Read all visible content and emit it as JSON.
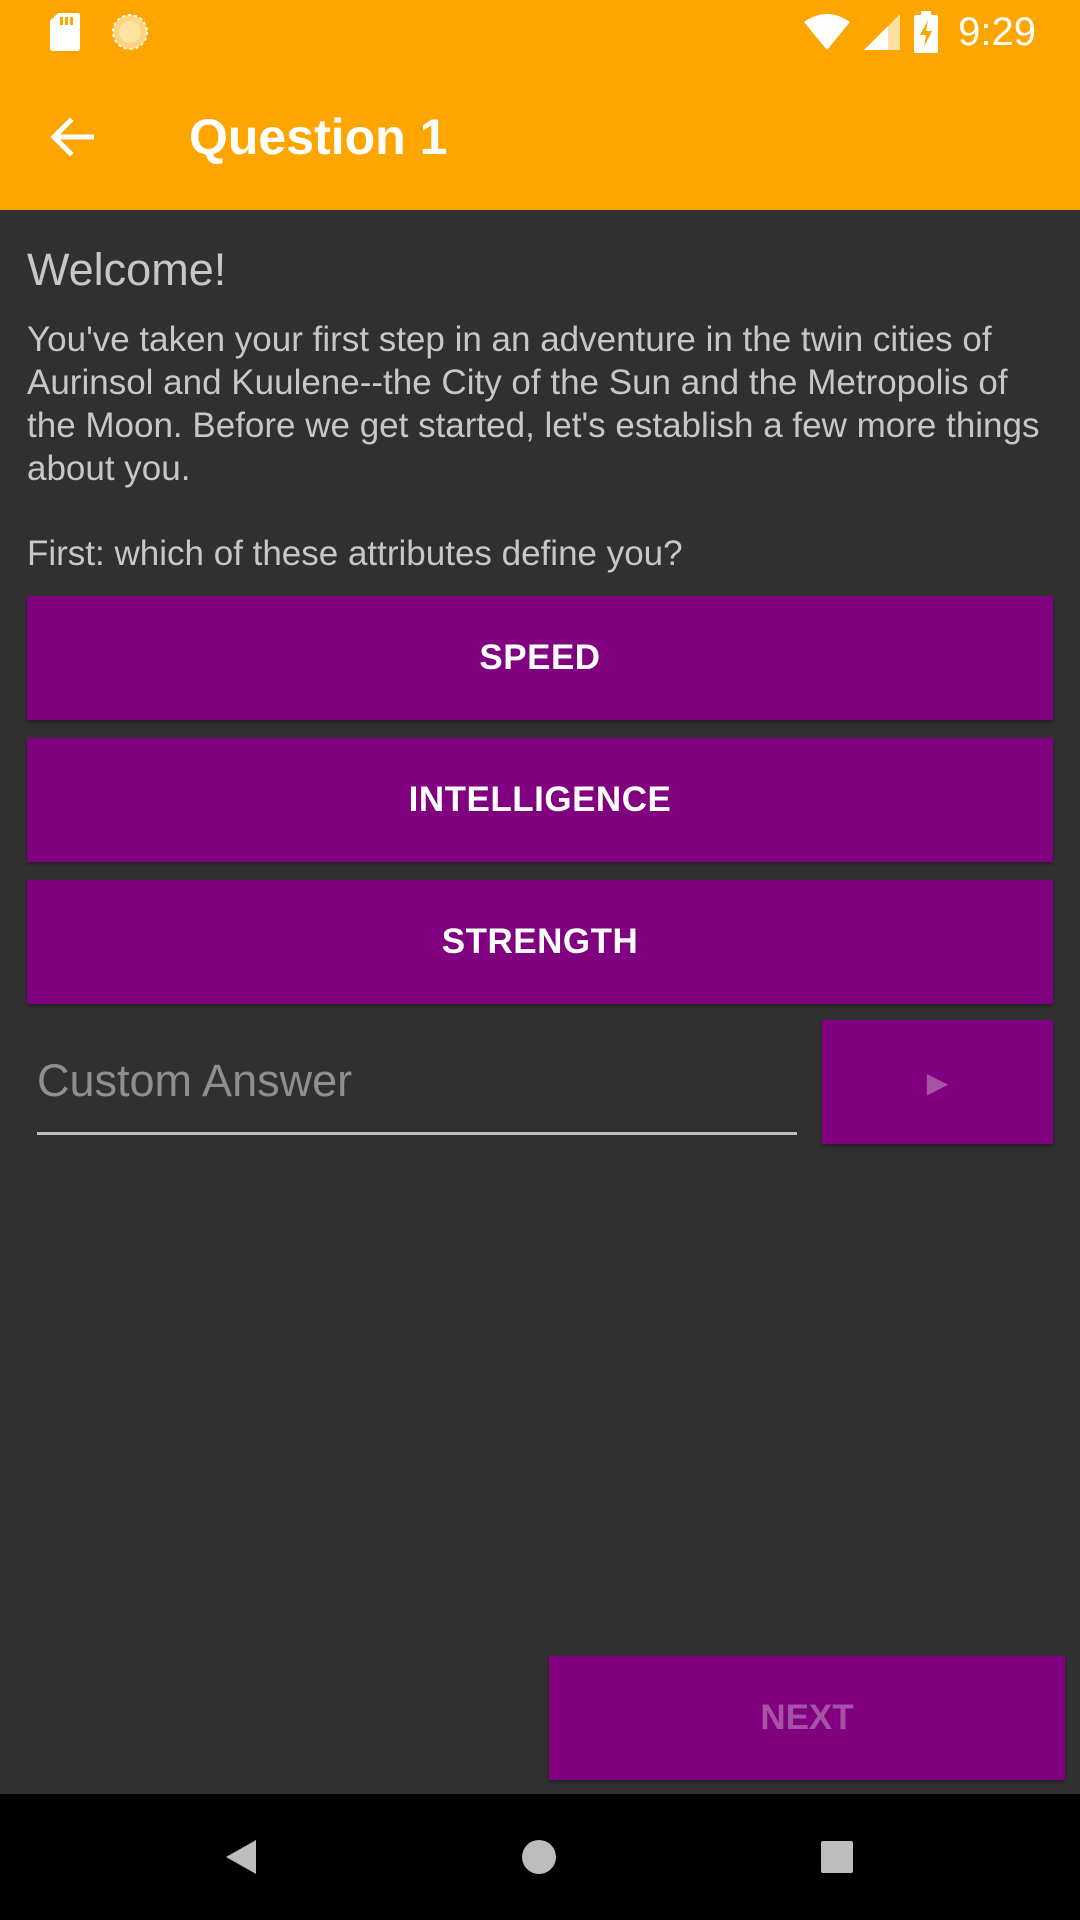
{
  "status_bar": {
    "time": "9:29",
    "icons": [
      "sd-card-icon",
      "sun-icon",
      "wifi-icon",
      "signal-icon",
      "battery-charging-icon"
    ]
  },
  "app_bar": {
    "title": "Question 1",
    "back_icon": "arrow-left-icon"
  },
  "content": {
    "heading": "Welcome!",
    "intro": "You've taken your first step in an adventure in the twin cities of Aurinsol and Kuulene--the City of the Sun and the Metropolis of the Moon. Before we get started, let's establish a few more things about you.",
    "question": "First: which of these attributes define you?",
    "options": [
      {
        "label": "SPEED"
      },
      {
        "label": "INTELLIGENCE"
      },
      {
        "label": "STRENGTH"
      }
    ],
    "custom_answer": {
      "placeholder": "Custom Answer",
      "value": ""
    },
    "submit_glyph": "▶",
    "next_label": "NEXT"
  },
  "nav_bar": {
    "icons": [
      "nav-back-icon",
      "nav-home-icon",
      "nav-recents-icon"
    ]
  },
  "colors": {
    "accent": "#FFA500",
    "button": "#800080",
    "background": "#303030",
    "disabled_text": "#A653A6"
  }
}
